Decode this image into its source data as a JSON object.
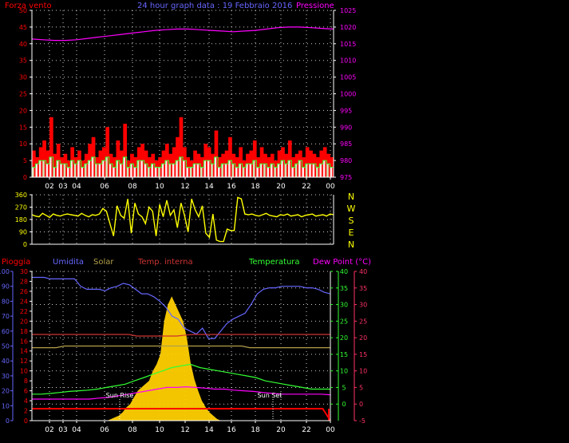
{
  "colors": {
    "background": "#000000",
    "axis": "#ffffff",
    "grid": "#ffffff",
    "wind": "#ff0000",
    "pressure": "#ff00ff",
    "direction": "#ffff00",
    "rain": "#ff0000",
    "humidity": "#6666ff",
    "solar": "#b3a04a",
    "temp_internal": "#cc3333",
    "temperature": "#33ff33",
    "dewpoint": "#ff00ff",
    "dewpoint_axis": "#ff3366",
    "sun_fill": "#ffd000",
    "sun_label": "#ffffff"
  },
  "chart_data": [
    {
      "type": "line",
      "title": "24 hour graph data : 19 Febbraio 2016",
      "left_label": "Forza vento",
      "right_label": "Pressione",
      "x_tick_labels": [
        "02",
        "03",
        "04",
        "06",
        "08",
        "10",
        "12",
        "14",
        "16",
        "18",
        "20",
        "22",
        "00"
      ],
      "y_left_ticks": [
        "0",
        "5",
        "10",
        "15",
        "20",
        "25",
        "30",
        "35",
        "40",
        "45",
        "50"
      ],
      "y_left_range": [
        0,
        50
      ],
      "y_right_ticks": [
        "975",
        "980",
        "985",
        "990",
        "995",
        "1000",
        "1005",
        "1010",
        "1015",
        "1020",
        "1025"
      ],
      "y_right_range": [
        975,
        1025
      ],
      "grid": true,
      "series": [
        {
          "key": "wind_gust",
          "color": "#ff0000",
          "values": [
            8,
            6,
            9,
            11,
            8,
            18,
            7,
            10,
            6,
            7,
            5,
            9,
            6,
            8,
            5,
            7,
            10,
            12,
            6,
            8,
            9,
            15,
            7,
            6,
            11,
            8,
            16,
            5,
            7,
            6,
            9,
            10,
            8,
            6,
            7,
            5,
            6,
            8,
            10,
            7,
            9,
            12,
            18,
            9,
            6,
            5,
            8,
            7,
            6,
            10,
            9,
            7,
            14,
            6,
            7,
            8,
            12,
            7,
            6,
            9,
            5,
            7,
            8,
            11,
            6,
            9,
            7,
            6,
            7,
            5,
            8,
            9,
            7,
            11,
            6,
            7,
            8,
            6,
            9,
            8,
            7,
            6,
            8,
            9,
            7,
            6
          ]
        },
        {
          "key": "wind_speed",
          "color": "#33ff33",
          "values": [
            3,
            4,
            5,
            5,
            4,
            6,
            3,
            5,
            4,
            4,
            3,
            5,
            4,
            5,
            3,
            4,
            5,
            6,
            4,
            4,
            5,
            6,
            4,
            3,
            5,
            4,
            6,
            3,
            4,
            3,
            5,
            5,
            4,
            3,
            4,
            3,
            3,
            4,
            5,
            4,
            4,
            5,
            6,
            5,
            3,
            3,
            4,
            4,
            3,
            5,
            5,
            4,
            6,
            3,
            4,
            4,
            5,
            4,
            3,
            4,
            3,
            4,
            4,
            5,
            3,
            4,
            4,
            3,
            4,
            3,
            4,
            5,
            4,
            5,
            3,
            4,
            5,
            3,
            4,
            4,
            4,
            3,
            4,
            5,
            4,
            3
          ]
        },
        {
          "key": "pressure",
          "color": "#ff00ff",
          "values": [
            1016.4,
            1016.2,
            1016.0,
            1016.0,
            1016.2,
            1016.6,
            1017.0,
            1017.4,
            1017.8,
            1018.2,
            1018.6,
            1019.0,
            1019.2,
            1019.4,
            1019.4,
            1019.2,
            1019.0,
            1018.8,
            1018.6,
            1018.8,
            1019.0,
            1019.4,
            1019.8,
            1020.0,
            1020.0,
            1019.8,
            1019.6,
            1019.4
          ]
        }
      ]
    },
    {
      "type": "line",
      "title": "",
      "y_ticks": [
        "0",
        "90",
        "180",
        "270",
        "360"
      ],
      "y_range": [
        0,
        360
      ],
      "right_labels": [
        "N",
        "W",
        "S",
        "E",
        "N"
      ],
      "series": [
        {
          "key": "wind_direction",
          "color": "#ffff00",
          "values": [
            215,
            205,
            200,
            225,
            210,
            195,
            220,
            210,
            205,
            215,
            220,
            215,
            210,
            205,
            225,
            210,
            200,
            215,
            210,
            220,
            260,
            240,
            150,
            60,
            280,
            210,
            190,
            330,
            80,
            300,
            220,
            200,
            150,
            270,
            240,
            60,
            290,
            200,
            320,
            210,
            250,
            120,
            300,
            210,
            90,
            330,
            250,
            200,
            280,
            80,
            50,
            220,
            30,
            20,
            20,
            110,
            100,
            100,
            340,
            330,
            220,
            215,
            220,
            210,
            205,
            215,
            225,
            210,
            205,
            200,
            215,
            210,
            220,
            205,
            210,
            215,
            200,
            210,
            215,
            220,
            205,
            210,
            215,
            205,
            220,
            215
          ]
        }
      ]
    },
    {
      "type": "line",
      "title": "",
      "labels": {
        "rain": "Pioggia",
        "humidity": "Umidita",
        "solar": "Solar",
        "temp_internal": "Temp. interna",
        "temperature": "Temperatura",
        "dewpoint": "Dew Point (°C)",
        "sunrise": "Sun Rise",
        "sunset": "Sun Set"
      },
      "x_tick_labels": [
        "02",
        "03",
        "04",
        "06",
        "08",
        "10",
        "12",
        "14",
        "16",
        "18",
        "20",
        "22",
        "00"
      ],
      "y_humidity_ticks": [
        "0",
        "10",
        "20",
        "30",
        "40",
        "50",
        "60",
        "70",
        "80",
        "90",
        "100"
      ],
      "y_rain_ticks": [
        "0",
        "2",
        "4",
        "6",
        "8",
        "10",
        "12",
        "14",
        "16",
        "18",
        "20",
        "22",
        "24",
        "26",
        "28",
        "30"
      ],
      "y_temp_ticks": [
        "0",
        "5",
        "10",
        "15",
        "20",
        "25",
        "30",
        "35",
        "40"
      ],
      "y_dew_ticks": [
        "-5",
        "0",
        "5",
        "10",
        "15",
        "20",
        "25",
        "30",
        "35",
        "40"
      ],
      "y_temp_range": [
        -5,
        40
      ],
      "series": [
        {
          "key": "humidity",
          "color": "#6666ff",
          "values": [
            96,
            96,
            96,
            95,
            95,
            95,
            95,
            95,
            90,
            88,
            88,
            88,
            87,
            89,
            90,
            92,
            91,
            88,
            85,
            85,
            83,
            80,
            76,
            70,
            68,
            62,
            60,
            58,
            62,
            55,
            55,
            60,
            65,
            68,
            70,
            72,
            78,
            85,
            88,
            89,
            89,
            90,
            90,
            90,
            90,
            89,
            89,
            88,
            86,
            85
          ]
        },
        {
          "key": "solar_line",
          "color": "#b3a04a",
          "values": [
            17,
            17,
            17,
            17,
            17.5,
            17.5,
            17.5,
            17.5,
            17.5,
            17.5,
            17.5,
            17.5,
            17.5,
            17.5,
            17.5,
            17.5,
            17.5,
            17.5,
            17.5,
            17.5,
            17.5,
            17.5,
            17.5,
            17.5,
            17.5,
            17.5,
            17.5,
            17,
            17,
            17,
            17,
            17,
            17,
            17,
            17,
            17,
            17,
            17
          ]
        },
        {
          "key": "temp_internal",
          "color": "#cc3333",
          "values": [
            21,
            21,
            21,
            21,
            21,
            21,
            21,
            21,
            21,
            21,
            21,
            21,
            21,
            20.5,
            20.5,
            20.5,
            20.5,
            20.5,
            20.5,
            20.8,
            21,
            21,
            21,
            21,
            21,
            21,
            21,
            21,
            21,
            21,
            21,
            21,
            21,
            21,
            21,
            21,
            21,
            21
          ]
        },
        {
          "key": "temperature",
          "color": "#33ff33",
          "values": [
            3,
            3,
            3.2,
            3.5,
            3.8,
            4,
            4.2,
            4.5,
            5,
            5.5,
            6,
            7,
            8,
            9,
            10,
            11,
            11.5,
            12,
            11,
            10.5,
            10,
            9.5,
            9,
            8.5,
            8,
            7,
            6.5,
            6,
            5.5,
            5,
            4.5,
            4.5,
            4.5
          ]
        },
        {
          "key": "dewpoint",
          "color": "#ff00ff",
          "values": [
            1.5,
            1.5,
            1.5,
            1.5,
            1.5,
            1.5,
            1.5,
            1.8,
            2,
            2.5,
            3,
            3.5,
            4,
            4.5,
            5,
            5,
            5.2,
            5,
            4.8,
            4.5,
            4.5,
            4.2,
            4,
            3.8,
            3.5,
            3.2,
            3,
            3,
            3,
            3,
            3,
            2.8
          ]
        },
        {
          "key": "rain",
          "color": "#ff0000",
          "values": [
            0.3,
            0.3,
            0.3,
            0.3,
            0.3,
            0.3,
            0.3,
            0.3,
            0.3,
            0.3,
            0.3,
            0.3,
            0.3,
            0.3,
            0.3,
            0.3,
            0.3,
            0.3,
            0.3,
            0.3,
            0.3,
            0.3,
            0.3,
            0.3,
            0.3,
            0.3,
            0.3,
            0.3,
            0.3,
            0.3,
            0.3,
            0.3,
            0.3,
            0.3,
            0.3,
            0.3,
            0.3,
            0.3,
            0.3,
            0
          ]
        },
        {
          "key": "solar_radiation",
          "color": "#ffd000",
          "values": [
            0,
            0,
            0,
            0,
            0,
            0,
            0,
            0,
            0,
            0,
            0,
            0,
            0,
            0,
            0,
            0,
            0,
            0,
            0,
            0,
            0,
            1,
            2,
            3,
            5,
            8,
            10,
            14,
            18,
            20,
            22,
            24,
            30,
            34,
            40,
            60,
            70,
            75,
            70,
            65,
            60,
            50,
            35,
            25,
            18,
            12,
            8,
            5,
            3,
            1,
            0,
            0,
            0,
            0,
            0,
            0,
            0,
            0,
            0,
            0,
            0,
            0,
            0,
            0,
            0,
            0,
            0,
            0,
            0,
            0,
            0,
            0,
            0,
            0,
            0,
            0,
            0,
            0,
            0,
            0
          ]
        }
      ]
    }
  ]
}
